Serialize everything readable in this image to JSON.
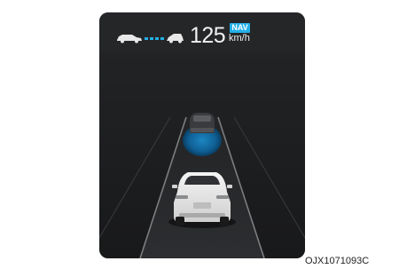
{
  "display": {
    "speed_value": "125",
    "speed_unit": "km/h",
    "mode_badge": "NAV",
    "accent_color": "#23b0e6",
    "icons": [
      "following-car-icon",
      "distance-dots-icon",
      "lead-car-icon"
    ]
  },
  "scene": {
    "icons": [
      "road-lanes",
      "lead-vehicle-icon",
      "own-vehicle-icon"
    ]
  },
  "caption": "OJX1071093C"
}
